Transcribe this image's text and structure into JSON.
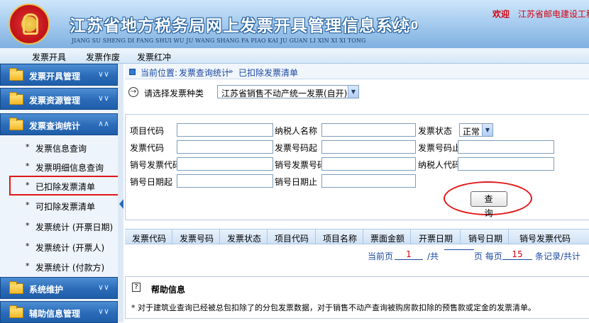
{
  "header": {
    "title": "江苏省地方税务局网上发票开具管理信息系统",
    "version": "V1.0",
    "pinyin": "JIANG SU SHENG DI FANG SHUI WU JU WANG SHANG FA PIAO KAI JU GUAN LI XIN XI XI TONG",
    "welcome_label": "欢迎",
    "welcome_user": "江苏省邮电建设工程"
  },
  "top_menu": [
    "发票开具",
    "发票作废",
    "发票红冲"
  ],
  "sidebar": {
    "groups": [
      {
        "label": "发票开具管理",
        "chevron": "double-chevron-down"
      },
      {
        "label": "发票资源管理",
        "chevron": "double-chevron-down"
      },
      {
        "label": "发票查询统计",
        "chevron": "double-chevron-up"
      },
      {
        "label": "系统维护",
        "chevron": "double-chevron-down"
      },
      {
        "label": "辅助信息管理",
        "chevron": "double-chevron-down"
      }
    ],
    "items": [
      {
        "label": "发票信息查询"
      },
      {
        "label": "发票明细信息查询"
      },
      {
        "label": "已扣除发票清单"
      },
      {
        "label": "可扣除发票清单"
      },
      {
        "label": "发票统计 (开票日期)"
      },
      {
        "label": "发票统计 (开票人)"
      },
      {
        "label": "发票统计 (付款方)"
      }
    ],
    "bullet": "*"
  },
  "breadcrumb": {
    "prefix": "当前位置:",
    "section": "发票查询统计",
    "arrow": "-»",
    "current": "已扣除发票清单"
  },
  "type_selector": {
    "label": "请选择发票种类",
    "value": "江苏省销售不动产统一发票(自开)"
  },
  "filters": {
    "project_code": "项目代码",
    "taxpayer_name": "纳税人名称",
    "invoice_status": "发票状态",
    "status_value": "正常",
    "invoice_code": "发票代码",
    "invoice_no_start": "发票号码起",
    "invoice_no_end": "发票号码止",
    "cancel_invoice_code": "销号发票代码",
    "cancel_invoice_no": "销号发票号码",
    "taxpayer_code": "纳税人代码",
    "cancel_date_start": "销号日期起",
    "cancel_date_end": "销号日期止"
  },
  "query_button": "查 询",
  "table": {
    "columns": [
      "发票代码",
      "发票号码",
      "发票状态",
      "项目代码",
      "项目名称",
      "票面金额",
      "开票日期",
      "销号日期",
      "销号发票代码"
    ]
  },
  "pager": {
    "current_label": "当前页",
    "current_page": "1",
    "total_label": "/共",
    "total_pages": "",
    "per_page_label": "页 每页",
    "per_page": "15",
    "records_label": "条记录/共计"
  },
  "help": {
    "title": "帮助信息",
    "text": "* 对于建筑业查询已经被总包扣除了的分包发票数据，对于销售不动产查询被购房款扣除的预售款或定金的发票清单。"
  },
  "colors": {
    "header_bg": "#a8cdf0",
    "group_bg": "#2a6bb8",
    "highlight_red": "#e01818",
    "link_blue": "#1a48a0"
  }
}
